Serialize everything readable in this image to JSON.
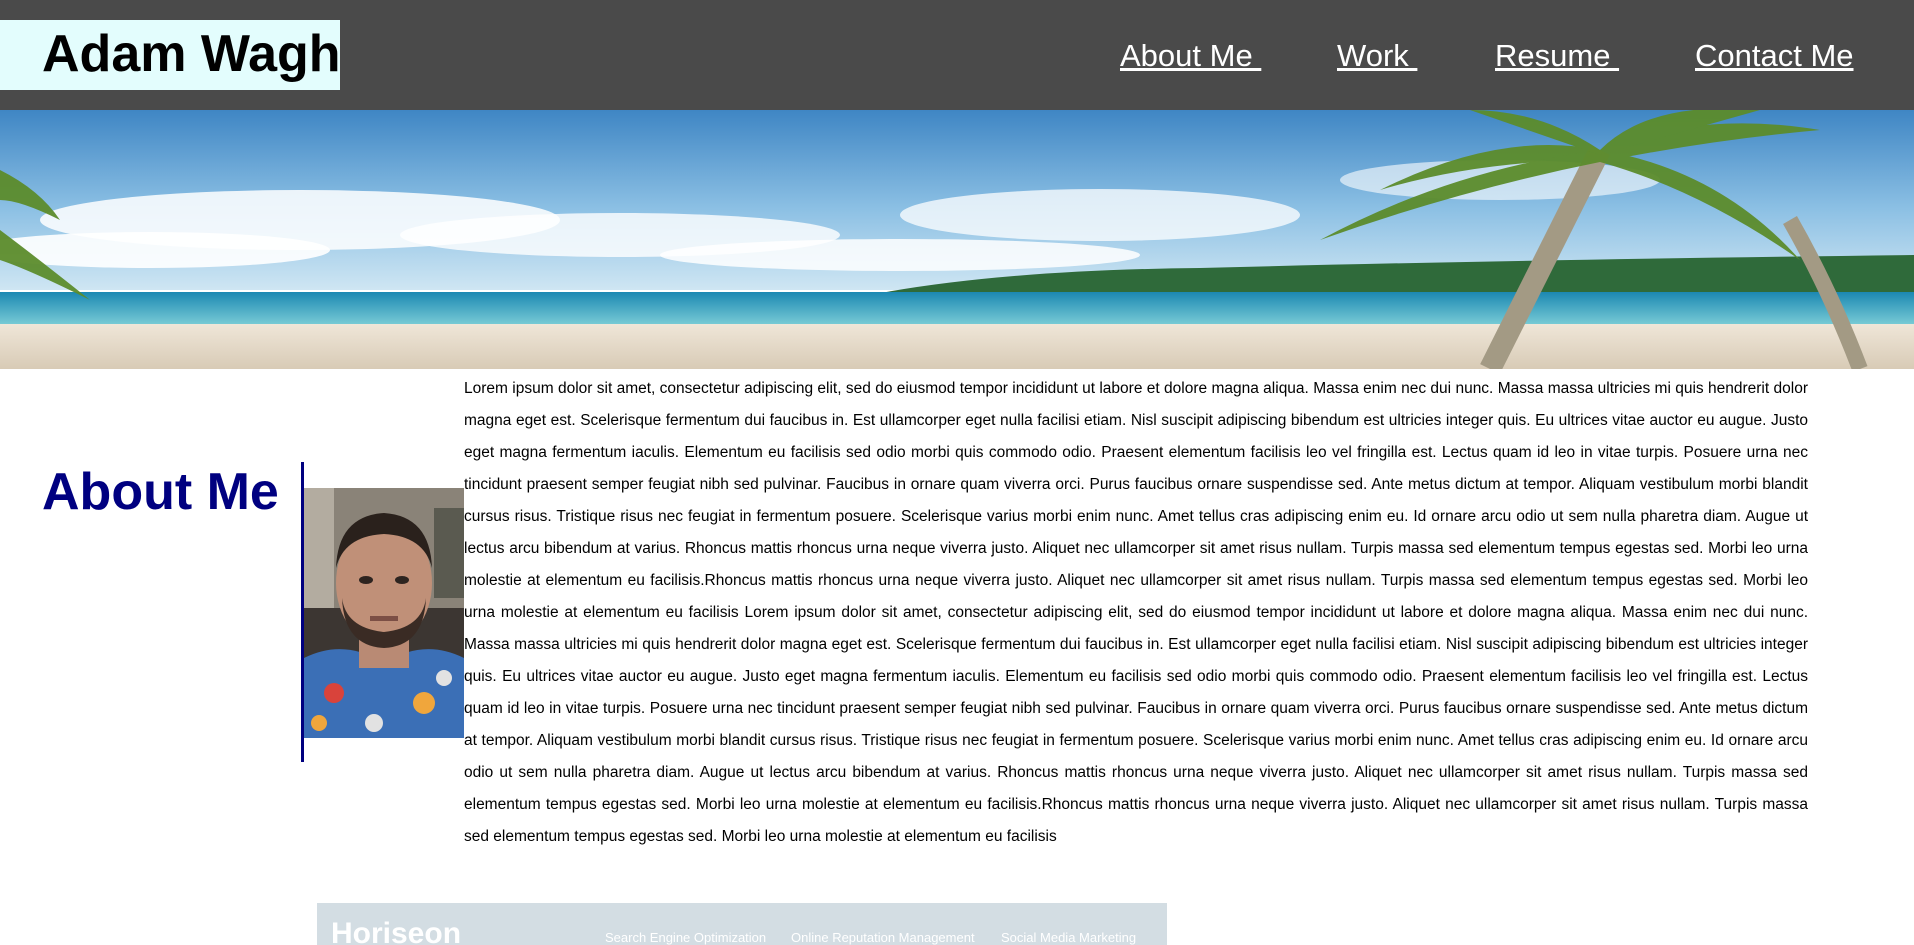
{
  "header": {
    "logo": "Adam Wagh",
    "nav": [
      "About Me ",
      "Work ",
      "Resume ",
      "Contact Me"
    ]
  },
  "about": {
    "heading": "About Me",
    "text": "Lorem ipsum dolor sit amet, consectetur adipiscing elit, sed do eiusmod tempor incididunt ut labore et dolore magna aliqua. Massa enim nec dui nunc. Massa massa ultricies mi quis hendrerit dolor magna eget est. Scelerisque fermentum dui faucibus in. Est ullamcorper eget nulla facilisi etiam. Nisl suscipit adipiscing bibendum est ultricies integer quis. Eu ultrices vitae auctor eu augue. Justo eget magna fermentum iaculis. Elementum eu facilisis sed odio morbi quis commodo odio. Praesent elementum facilisis leo vel fringilla est. Lectus quam id leo in vitae turpis. Posuere urna nec tincidunt praesent semper feugiat nibh sed pulvinar. Faucibus in ornare quam viverra orci. Purus faucibus ornare suspendisse sed. Ante metus dictum at tempor. Aliquam vestibulum morbi blandit cursus risus. Tristique risus nec feugiat in fermentum posuere. Scelerisque varius morbi enim nunc. Amet tellus cras adipiscing enim eu. Id ornare arcu odio ut sem nulla pharetra diam. Augue ut lectus arcu bibendum at varius. Rhoncus mattis rhoncus urna neque viverra justo. Aliquet nec ullamcorper sit amet risus nullam. Turpis massa sed elementum tempus egestas sed. Morbi leo urna molestie at elementum eu facilisis.Rhoncus mattis rhoncus urna neque viverra justo. Aliquet nec ullamcorper sit amet risus nullam. Turpis massa sed elementum tempus egestas sed. Morbi leo urna molestie at elementum eu facilisis Lorem ipsum dolor sit amet, consectetur adipiscing elit, sed do eiusmod tempor incididunt ut labore et dolore magna aliqua. Massa enim nec dui nunc. Massa massa ultricies mi quis hendrerit dolor magna eget est. Scelerisque fermentum dui faucibus in. Est ullamcorper eget nulla facilisi etiam. Nisl suscipit adipiscing bibendum est ultricies integer quis. Eu ultrices vitae auctor eu augue. Justo eget magna fermentum iaculis. Elementum eu facilisis sed odio morbi quis commodo odio. Praesent elementum facilisis leo vel fringilla est. Lectus quam id leo in vitae turpis. Posuere urna nec tincidunt praesent semper feugiat nibh sed pulvinar. Faucibus in ornare quam viverra orci. Purus faucibus ornare suspendisse sed. Ante metus dictum at tempor. Aliquam vestibulum morbi blandit cursus risus. Tristique risus nec feugiat in fermentum posuere. Scelerisque varius morbi enim nunc. Amet tellus cras adipiscing enim eu. Id ornare arcu odio ut sem nulla pharetra diam. Augue ut lectus arcu bibendum at varius. Rhoncus mattis rhoncus urna neque viverra justo. Aliquet nec ullamcorper sit amet risus nullam. Turpis massa sed elementum tempus egestas sed. Morbi leo urna molestie at elementum eu facilisis.Rhoncus mattis rhoncus urna neque viverra justo. Aliquet nec ullamcorper sit amet risus nullam. Turpis massa sed elementum tempus egestas sed. Morbi leo urna molestie at elementum eu facilisis"
  },
  "work_preview": {
    "brand": "Horiseon",
    "nav": [
      "Search Engine Optimization",
      "Online Reputation Management",
      "Social Media Marketing"
    ]
  },
  "colors": {
    "header_bg": "#4a4a4a",
    "logo_bg": "#e3fdfd",
    "heading": "#000080",
    "nav_text": "#ffffff"
  },
  "icons": {
    "hero": "beach-palm-banner-image",
    "photo": "profile-photo"
  }
}
